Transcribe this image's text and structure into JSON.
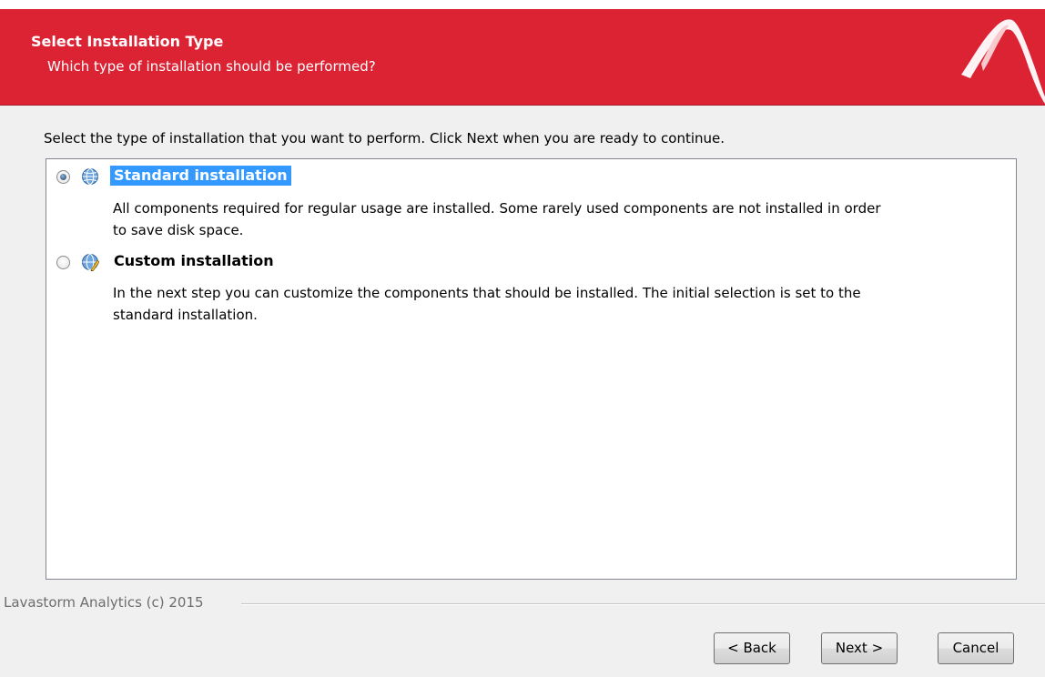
{
  "header": {
    "title": "Select Installation Type",
    "subtitle": "Which type of installation should be performed?",
    "background_color": "#dc2334",
    "logo_icon": "lavastorm-logo-icon"
  },
  "instruction": "Select the type of installation that you want to perform. Click Next when you are ready to continue.",
  "options": [
    {
      "label": "Standard installation",
      "description_line1": "All components required for regular usage are installed. Some rarely used components are not installed in order",
      "description_line2": "to save disk space.",
      "selected": true,
      "icon": "globe-icon"
    },
    {
      "label": "Custom installation",
      "description_line1": "In the next step you can customize the components that should be installed. The initial selection is set to the",
      "description_line2": "standard installation.",
      "selected": false,
      "icon": "globe-pencil-icon"
    }
  ],
  "footer": {
    "copyright": "Lavastorm Analytics (c) 2015"
  },
  "buttons": {
    "back": "< Back",
    "next": "Next >",
    "cancel": "Cancel"
  }
}
